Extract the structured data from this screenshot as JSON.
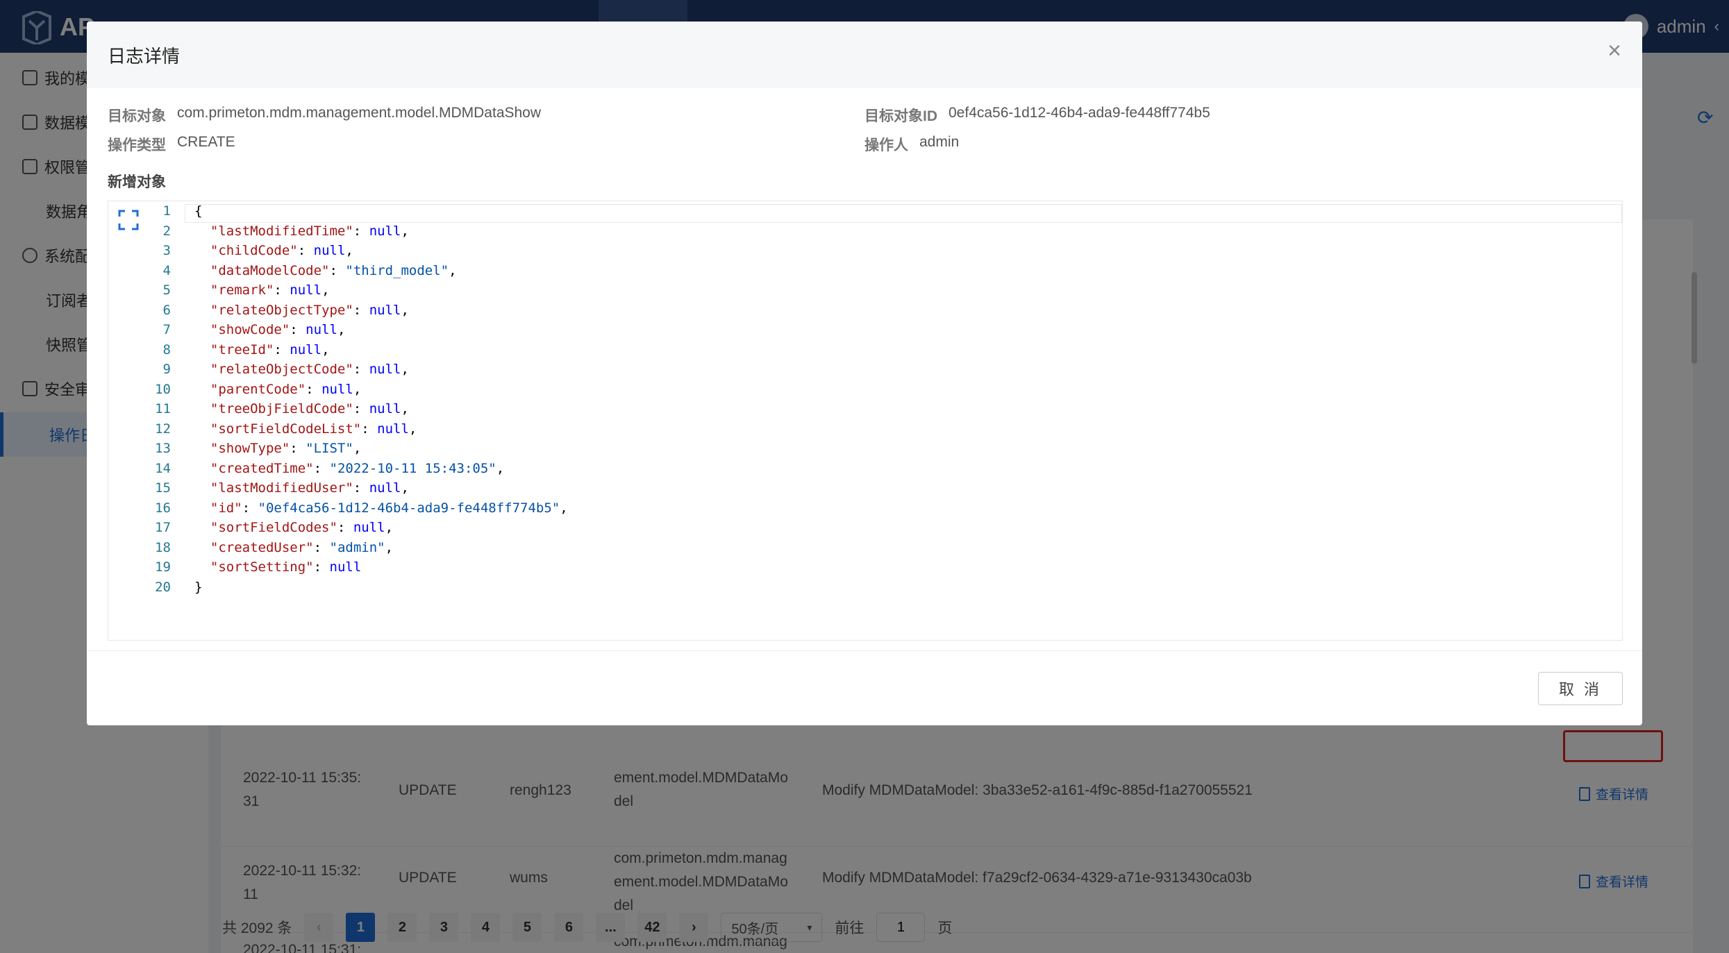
{
  "app": {
    "name": "AP",
    "user": "admin"
  },
  "sidebar": {
    "items": [
      {
        "label": "我的模"
      },
      {
        "label": "数据模"
      },
      {
        "label": "权限管"
      },
      {
        "label": "数据角"
      },
      {
        "label": "系统配"
      },
      {
        "label": "订阅者"
      },
      {
        "label": "快照管"
      },
      {
        "label": "安全审"
      },
      {
        "label": "操作日"
      }
    ]
  },
  "table": {
    "link_label": "查看详情",
    "rows": [
      {
        "time": "2022-10-11 15:35:\n31",
        "type": "UPDATE",
        "user": "rengh123",
        "object": "ement.model.MDMDataMo\ndel",
        "detail": "Modify MDMDataModel: 3ba33e52-a161-4f9c-885d-f1a270055521"
      },
      {
        "time": "2022-10-11 15:32:\n11",
        "type": "UPDATE",
        "user": "wums",
        "object": "com.primeton.mdm.manag\nement.model.MDMDataMo\ndel",
        "detail": "Modify MDMDataModel: f7a29cf2-0634-4329-a71e-9313430ca03b"
      },
      {
        "time": "2022-10-11 15:31:",
        "type": "",
        "user": "",
        "object": "com.primeton.mdm.manag",
        "detail": ""
      }
    ]
  },
  "pagination": {
    "total": "共 2092 条",
    "prev": "‹",
    "next": "›",
    "pages": [
      "1",
      "2",
      "3",
      "4",
      "5",
      "6",
      "...",
      "42"
    ],
    "current_page": 1,
    "page_size": "50条/页",
    "goto_label": "前往",
    "goto_value": "1",
    "page_suffix": "页"
  },
  "dialog": {
    "title": "日志详情",
    "close": "×",
    "target_object_label": "目标对象",
    "target_object": "com.primeton.mdm.management.model.MDMDataShow",
    "target_id_label": "目标对象ID",
    "target_id": "0ef4ca56-1d12-46b4-ada9-fe448ff774b5",
    "op_type_label": "操作类型",
    "op_type": "CREATE",
    "operator_label": "操作人",
    "operator": "admin",
    "section_title": "新增对象",
    "cancel": "取 消",
    "code_lines": [
      [
        [
          "p",
          "{"
        ]
      ],
      [
        [
          "k",
          "\"lastModifiedTime\""
        ],
        [
          "p",
          ": "
        ],
        [
          "n",
          "null"
        ],
        [
          "p",
          ","
        ]
      ],
      [
        [
          "k",
          "\"childCode\""
        ],
        [
          "p",
          ": "
        ],
        [
          "n",
          "null"
        ],
        [
          "p",
          ","
        ]
      ],
      [
        [
          "k",
          "\"dataModelCode\""
        ],
        [
          "p",
          ": "
        ],
        [
          "s",
          "\"third_model\""
        ],
        [
          "p",
          ","
        ]
      ],
      [
        [
          "k",
          "\"remark\""
        ],
        [
          "p",
          ": "
        ],
        [
          "n",
          "null"
        ],
        [
          "p",
          ","
        ]
      ],
      [
        [
          "k",
          "\"relateObjectType\""
        ],
        [
          "p",
          ": "
        ],
        [
          "n",
          "null"
        ],
        [
          "p",
          ","
        ]
      ],
      [
        [
          "k",
          "\"showCode\""
        ],
        [
          "p",
          ": "
        ],
        [
          "n",
          "null"
        ],
        [
          "p",
          ","
        ]
      ],
      [
        [
          "k",
          "\"treeId\""
        ],
        [
          "p",
          ": "
        ],
        [
          "n",
          "null"
        ],
        [
          "p",
          ","
        ]
      ],
      [
        [
          "k",
          "\"relateObjectCode\""
        ],
        [
          "p",
          ": "
        ],
        [
          "n",
          "null"
        ],
        [
          "p",
          ","
        ]
      ],
      [
        [
          "k",
          "\"parentCode\""
        ],
        [
          "p",
          ": "
        ],
        [
          "n",
          "null"
        ],
        [
          "p",
          ","
        ]
      ],
      [
        [
          "k",
          "\"treeObjFieldCode\""
        ],
        [
          "p",
          ": "
        ],
        [
          "n",
          "null"
        ],
        [
          "p",
          ","
        ]
      ],
      [
        [
          "k",
          "\"sortFieldCodeList\""
        ],
        [
          "p",
          ": "
        ],
        [
          "n",
          "null"
        ],
        [
          "p",
          ","
        ]
      ],
      [
        [
          "k",
          "\"showType\""
        ],
        [
          "p",
          ": "
        ],
        [
          "s",
          "\"LIST\""
        ],
        [
          "p",
          ","
        ]
      ],
      [
        [
          "k",
          "\"createdTime\""
        ],
        [
          "p",
          ": "
        ],
        [
          "s",
          "\"2022-10-11 15:43:05\""
        ],
        [
          "p",
          ","
        ]
      ],
      [
        [
          "k",
          "\"lastModifiedUser\""
        ],
        [
          "p",
          ": "
        ],
        [
          "n",
          "null"
        ],
        [
          "p",
          ","
        ]
      ],
      [
        [
          "k",
          "\"id\""
        ],
        [
          "p",
          ": "
        ],
        [
          "s",
          "\"0ef4ca56-1d12-46b4-ada9-fe448ff774b5\""
        ],
        [
          "p",
          ","
        ]
      ],
      [
        [
          "k",
          "\"sortFieldCodes\""
        ],
        [
          "p",
          ": "
        ],
        [
          "n",
          "null"
        ],
        [
          "p",
          ","
        ]
      ],
      [
        [
          "k",
          "\"createdUser\""
        ],
        [
          "p",
          ": "
        ],
        [
          "s",
          "\"admin\""
        ],
        [
          "p",
          ","
        ]
      ],
      [
        [
          "k",
          "\"sortSetting\""
        ],
        [
          "p",
          ": "
        ],
        [
          "n",
          "null"
        ]
      ],
      [
        [
          "p",
          "}"
        ]
      ]
    ]
  },
  "colors": {
    "accent": "#1f6fd6",
    "topbar": "#1f3a6e",
    "highlight": "#e02020"
  }
}
